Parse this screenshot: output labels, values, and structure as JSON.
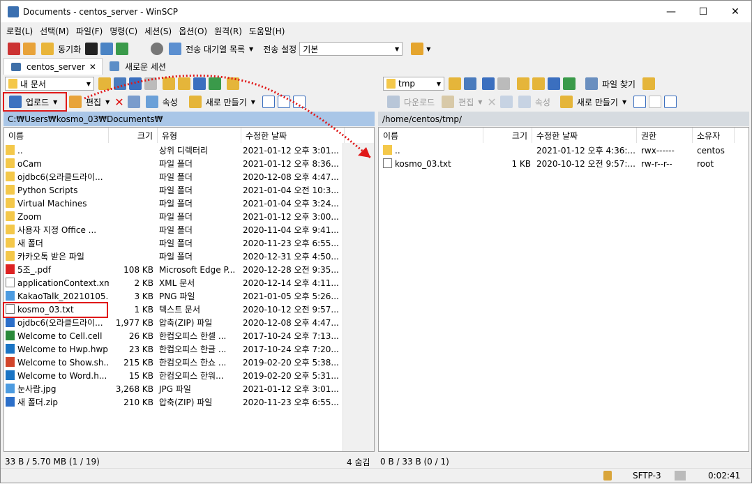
{
  "window": {
    "title": "Documents - centos_server - WinSCP",
    "min": "—",
    "max": "☐",
    "close": "✕"
  },
  "menu": [
    "로컬(L)",
    "선택(M)",
    "파일(F)",
    "명령(C)",
    "세션(S)",
    "옵션(O)",
    "원격(R)",
    "도움말(H)"
  ],
  "toolbar": {
    "sync": "동기화",
    "queue": "전송 대기열 목록",
    "transfer_label": "전송 설정",
    "transfer_value": "기본"
  },
  "tabs": {
    "session": "centos_server",
    "new_session": "새로운 세션",
    "close": "✕"
  },
  "left": {
    "location": "내 문서",
    "upload": "업로드",
    "edit": "편집",
    "props": "속성",
    "new": "새로 만들기",
    "path": "C:₩Users₩kosmo_03₩Documents₩",
    "columns": [
      "이름",
      "크기",
      "유형",
      "수정한 날짜"
    ],
    "rows": [
      {
        "icon": "up",
        "name": "..",
        "size": "",
        "type": "상위 디렉터리",
        "date": "2021-01-12  오후 3:01..."
      },
      {
        "icon": "folder",
        "name": "oCam",
        "size": "",
        "type": "파일 폴더",
        "date": "2021-01-12  오후 8:36..."
      },
      {
        "icon": "folder",
        "name": "ojdbc6(오라클드라이...",
        "size": "",
        "type": "파일 폴더",
        "date": "2020-12-08  오후 4:47..."
      },
      {
        "icon": "folder",
        "name": "Python Scripts",
        "size": "",
        "type": "파일 폴더",
        "date": "2021-01-04  오전 10:3..."
      },
      {
        "icon": "folder",
        "name": "Virtual Machines",
        "size": "",
        "type": "파일 폴더",
        "date": "2021-01-04  오후 3:24..."
      },
      {
        "icon": "folder",
        "name": "Zoom",
        "size": "",
        "type": "파일 폴더",
        "date": "2021-01-12  오후 3:00..."
      },
      {
        "icon": "folder",
        "name": "사용자 지정 Office ...",
        "size": "",
        "type": "파일 폴더",
        "date": "2020-11-04  오후 9:41..."
      },
      {
        "icon": "folder",
        "name": "새 폴더",
        "size": "",
        "type": "파일 폴더",
        "date": "2020-11-23  오후 6:55..."
      },
      {
        "icon": "folder",
        "name": "카카오톡 받은 파일",
        "size": "",
        "type": "파일 폴더",
        "date": "2020-12-31  오후 4:50..."
      },
      {
        "icon": "pdf",
        "name": "5조_.pdf",
        "size": "108 KB",
        "type": "Microsoft Edge P...",
        "date": "2020-12-28  오전 9:35..."
      },
      {
        "icon": "doc",
        "name": "applicationContext.xml",
        "size": "2 KB",
        "type": "XML 문서",
        "date": "2020-12-14  오후 4:11..."
      },
      {
        "icon": "img",
        "name": "KakaoTalk_20210105...",
        "size": "3 KB",
        "type": "PNG 파일",
        "date": "2021-01-05  오후 5:26..."
      },
      {
        "icon": "doc",
        "name": "kosmo_03.txt",
        "size": "1 KB",
        "type": "텍스트 문서",
        "date": "2020-10-12  오전 9:57..."
      },
      {
        "icon": "zip",
        "name": "ojdbc6(오라클드라이...",
        "size": "1,977 KB",
        "type": "압축(ZIP) 파일",
        "date": "2020-12-08  오후 4:47..."
      },
      {
        "icon": "xls",
        "name": "Welcome to Cell.cell",
        "size": "26 KB",
        "type": "한컴오피스 한셀 ...",
        "date": "2017-10-24  오후 7:13..."
      },
      {
        "icon": "hwp",
        "name": "Welcome to Hwp.hwp",
        "size": "23 KB",
        "type": "한컴오피스 한글 ...",
        "date": "2017-10-24  오후 7:20..."
      },
      {
        "icon": "show",
        "name": "Welcome to Show.sh...",
        "size": "215 KB",
        "type": "한컴오피스 한쇼 ...",
        "date": "2019-02-20  오후 5:38..."
      },
      {
        "icon": "hwp",
        "name": "Welcome to Word.h...",
        "size": "15 KB",
        "type": "한컴오피스 한워...",
        "date": "2019-02-20  오후 5:31..."
      },
      {
        "icon": "img",
        "name": "눈사람.jpg",
        "size": "3,268 KB",
        "type": "JPG 파일",
        "date": "2021-01-12  오후 3:01..."
      },
      {
        "icon": "zip",
        "name": "새 폴더.zip",
        "size": "210 KB",
        "type": "압축(ZIP) 파일",
        "date": "2020-11-23  오후 6:55..."
      }
    ],
    "status": "33 B / 5.70 MB (1 / 19)",
    "hidden": "4 숨김"
  },
  "right": {
    "location": "tmp",
    "find": "파일 찾기",
    "download": "다운로드",
    "edit": "편집",
    "props": "속성",
    "new": "새로 만들기",
    "path": "/home/centos/tmp/",
    "columns": [
      "이름",
      "크기",
      "수정한 날짜",
      "권한",
      "소유자"
    ],
    "rows": [
      {
        "icon": "up",
        "name": "..",
        "size": "",
        "date": "2021-01-12  오후 4:36:...",
        "perm": "rwx------",
        "owner": "centos"
      },
      {
        "icon": "doc",
        "name": "kosmo_03.txt",
        "size": "1 KB",
        "date": "2020-10-12  오전 9:57:...",
        "perm": "rw-r--r--",
        "owner": "root"
      }
    ],
    "status": "0 B / 33 B (0 / 1)"
  },
  "statusbar": {
    "protocol": "SFTP-3",
    "time": "0:02:41"
  },
  "colors": {
    "accent": "#e01818",
    "path_active": "#a9c6e7"
  }
}
